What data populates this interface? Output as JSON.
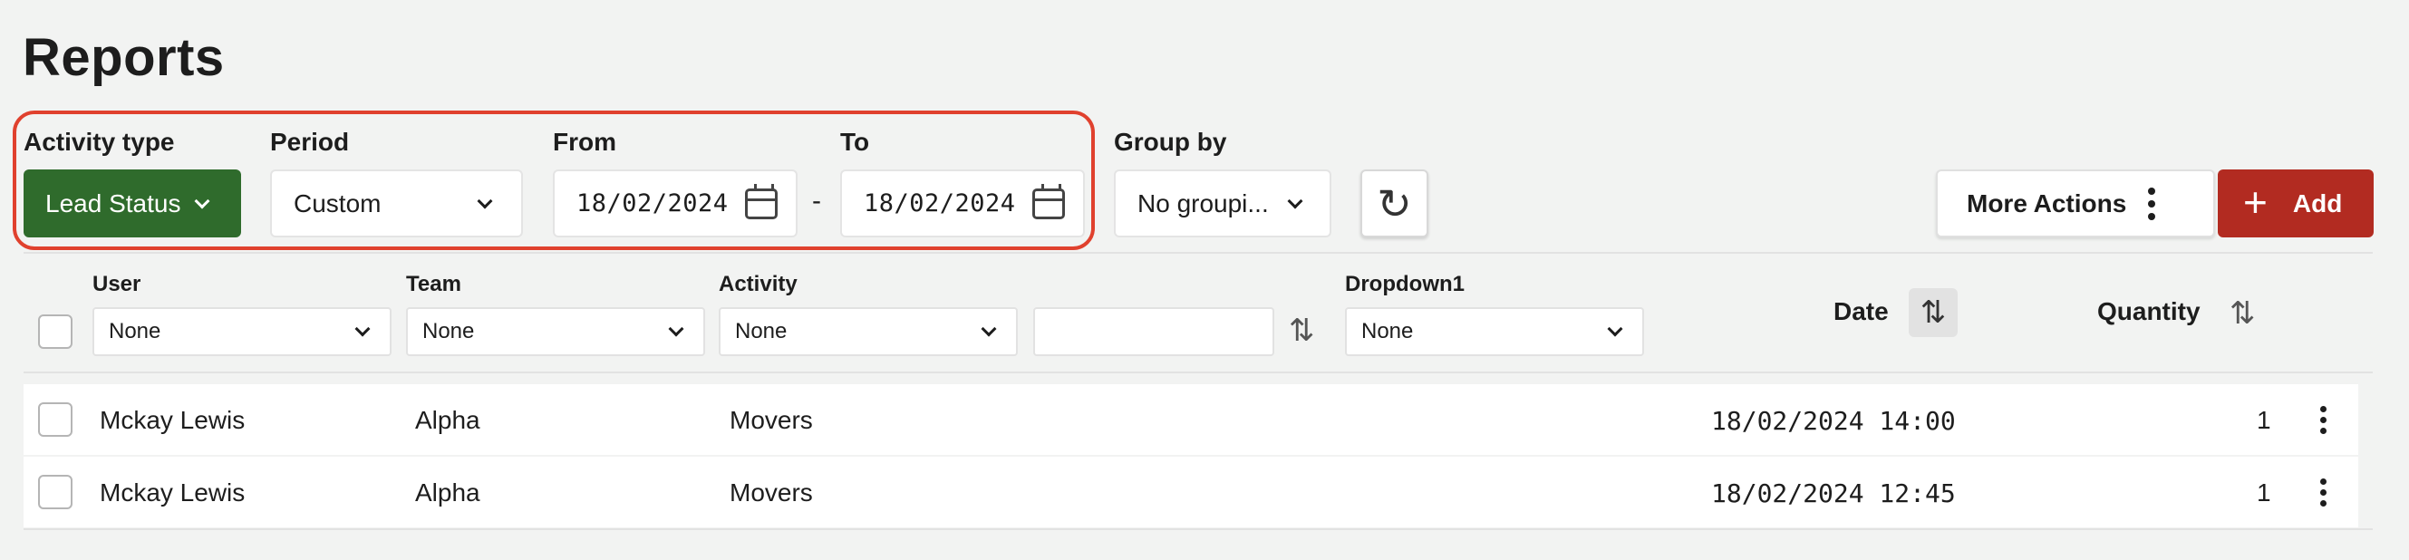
{
  "page": {
    "title": "Reports"
  },
  "filters": {
    "activity_type": {
      "label": "Activity type",
      "value": "Lead Status"
    },
    "period": {
      "label": "Period",
      "value": "Custom"
    },
    "from": {
      "label": "From",
      "value": "18/02/2024"
    },
    "to": {
      "label": "To",
      "value": "18/02/2024"
    },
    "range_separator": "-",
    "group_by": {
      "label": "Group by",
      "value": "No groupi..."
    }
  },
  "actions": {
    "refresh_icon": "refresh-icon",
    "more_actions_label": "More Actions",
    "add_label": "Add",
    "accent": "#b22b21",
    "primary_green": "#2f6b2c",
    "highlight_color": "#e0412e"
  },
  "table": {
    "columns": {
      "user": {
        "label": "User",
        "filter": "None"
      },
      "team": {
        "label": "Team",
        "filter": "None"
      },
      "activity": {
        "label": "Activity",
        "filter": "None"
      },
      "text_filter": {
        "value": ""
      },
      "dropdown1": {
        "label": "Dropdown1",
        "filter": "None"
      },
      "date": {
        "label": "Date"
      },
      "quantity": {
        "label": "Quantity"
      }
    },
    "rows": [
      {
        "user": "Mckay Lewis",
        "team": "Alpha",
        "activity": "Movers",
        "date": "18/02/2024 14:00",
        "quantity": "1"
      },
      {
        "user": "Mckay Lewis",
        "team": "Alpha",
        "activity": "Movers",
        "date": "18/02/2024 12:45",
        "quantity": "1"
      }
    ]
  }
}
